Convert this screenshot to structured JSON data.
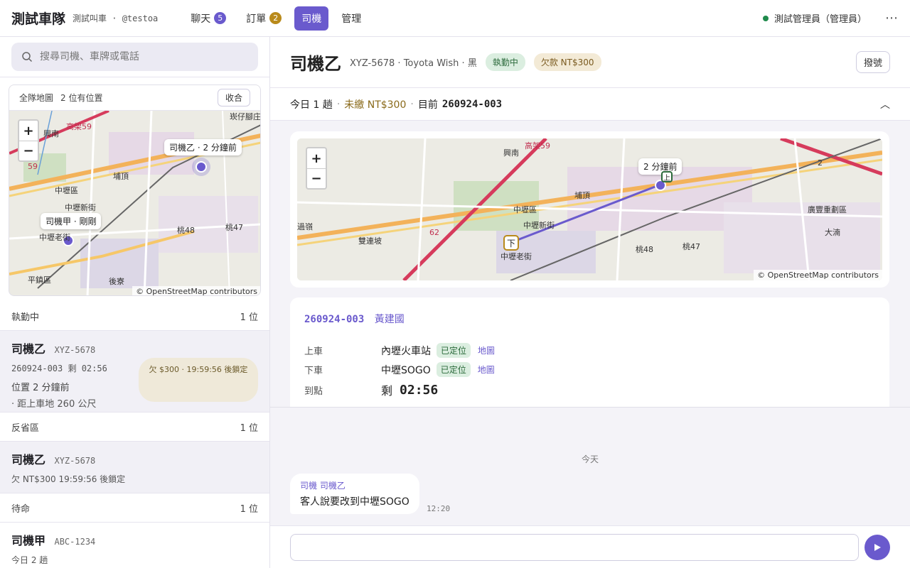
{
  "topbar": {
    "brand": "測試車隊",
    "subtitle": "測試叫車 · @testoa",
    "nav": [
      {
        "label": "聊天",
        "badge": "5",
        "badge_color": "#6a5acd"
      },
      {
        "label": "訂單",
        "badge": "2",
        "badge_color": "#b98a1b"
      },
      {
        "label": "司機",
        "badge": null
      },
      {
        "label": "管理",
        "badge": null
      }
    ],
    "active_nav": "司機",
    "user_label": "測試管理員（管理員）",
    "more_icon": "more-icon"
  },
  "sidebar": {
    "search_placeholder": "搜尋司機、車牌或電話",
    "fleet_map": {
      "title": "全隊地圖",
      "located_count": "2 位有位置",
      "collapse_label": "收合",
      "markers": [
        {
          "label": "司機乙 · 2 分鐘前"
        },
        {
          "label": "司機甲 · 剛剛"
        }
      ],
      "place_names": [
        "崁仔腳庄",
        "興南",
        "埔頂",
        "中壢區",
        "中壢新街",
        "中壢老街",
        "平鎮區",
        "後寮",
        "桃48",
        "桃47",
        "高架59",
        "59"
      ],
      "attribution": "© OpenStreetMap contributors"
    },
    "sections": [
      {
        "title": "執勤中",
        "count": "1 位",
        "cards": [
          {
            "name": "司機乙",
            "plate": "XYZ-5678",
            "line1": "260924-003 剩 02:56",
            "line2": "位置 2 分鐘前",
            "line3": "· 距上車地 260 公尺",
            "debt_note": "欠 $300 · 19:59:56 後鎖定"
          }
        ]
      },
      {
        "title": "反省區",
        "count": "1 位",
        "cards": [
          {
            "name": "司機乙",
            "plate": "XYZ-5678",
            "line1": "欠 NT$300 19:59:56 後鎖定"
          }
        ]
      },
      {
        "title": "待命",
        "count": "1 位",
        "cards": [
          {
            "name": "司機甲",
            "plate": "ABC-1234",
            "line1": "今日 2 趟"
          }
        ]
      }
    ]
  },
  "driver": {
    "name": "司機乙",
    "meta": "XYZ-5678 · Toyota Wish · 黑",
    "status": "執勤中",
    "debt": "欠款 NT$300",
    "dispatch_label": "撥號",
    "summary": {
      "trips": "今日 1 趟",
      "unpaid": "未繳 NT$300",
      "current_label": "目前",
      "current_order": "260924-003"
    }
  },
  "route_map": {
    "marker_label": "2 分鐘前",
    "pickup_tag": "上",
    "dropoff_tag": "下",
    "place_names": [
      "興南",
      "高架59",
      "埔頂",
      "中壢區",
      "中壢新街",
      "中壢老街",
      "過嶺",
      "雙連坡",
      "廣豐重劃區",
      "大湳",
      "桃48",
      "桃47",
      "62",
      "2"
    ],
    "attribution": "© OpenStreetMap contributors"
  },
  "order": {
    "id": "260924-003",
    "customer": "黃建國",
    "rows": [
      {
        "label": "上車",
        "value": "內壢火車站",
        "badge": "已定位",
        "link": "地圖"
      },
      {
        "label": "下車",
        "value": "中壢SOGO",
        "badge": "已定位",
        "link": "地圖"
      }
    ],
    "eta_label": "到點",
    "eta_prefix": "剩",
    "eta_value": "02:56"
  },
  "chat": {
    "day_label": "今天",
    "messages": [
      {
        "sender": "司機 司機乙",
        "text": "客人說要改到中壢SOGO",
        "time": "12:20"
      }
    ],
    "input_placeholder": ""
  },
  "colors": {
    "accent": "#6a5acd",
    "online": "#1f8a4c",
    "warning": "#b98a1b"
  }
}
